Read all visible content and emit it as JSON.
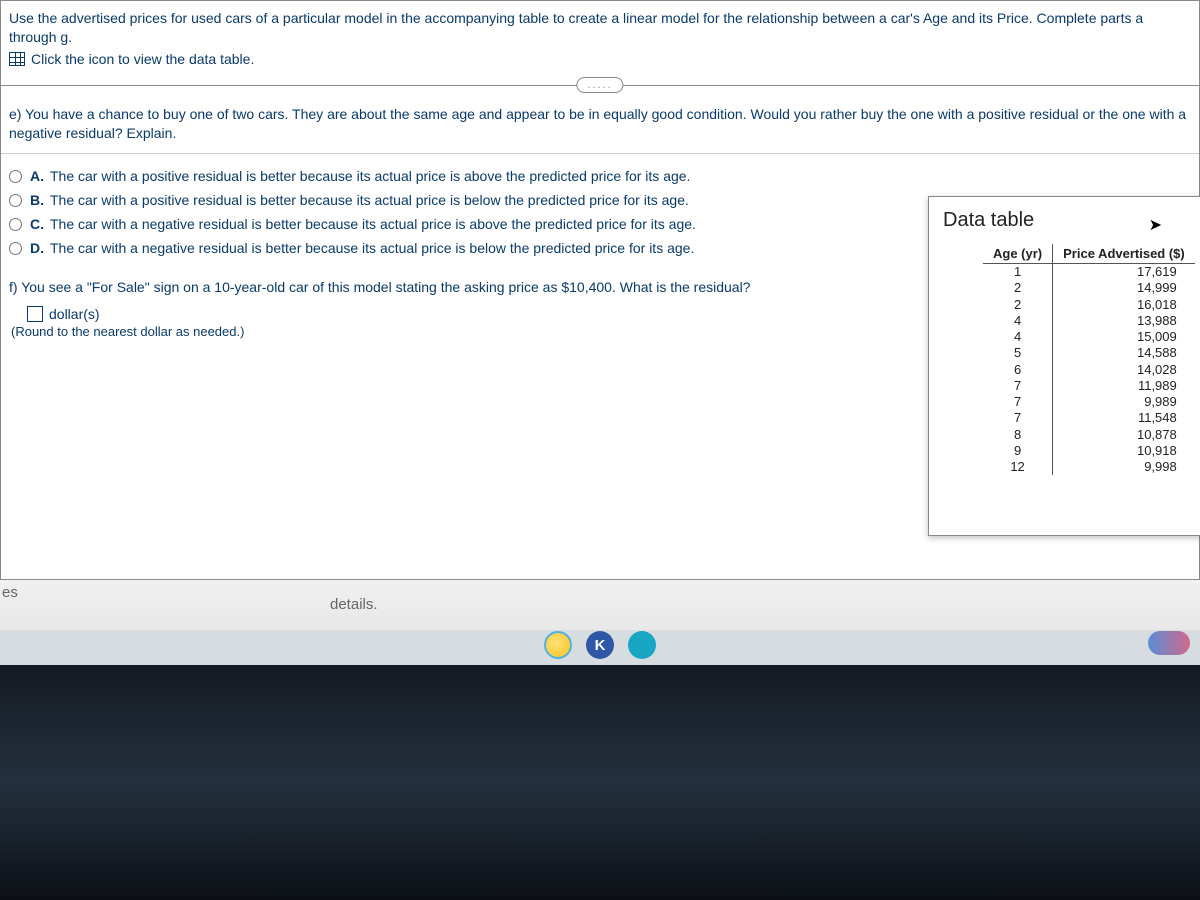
{
  "intro": "Use the advertised prices for used cars of a particular model in the accompanying table to create a linear model for the relationship between a car's Age and its Price. Complete parts a through g.",
  "dataLinkText": "Click the icon to view the data table.",
  "divider": ".....",
  "questionE": "e) You have a chance to buy one of two cars. They are about the same age and appear to be in equally good condition. Would you rather buy the one with a positive residual or the one with a negative residual? Explain.",
  "options": [
    {
      "key": "A.",
      "text": "The car with a positive residual is better because its actual price is above the predicted price for its age."
    },
    {
      "key": "B.",
      "text": "The car with a positive residual is better because its actual price is below the predicted price for its age."
    },
    {
      "key": "C.",
      "text": "The car with a negative residual is better because its actual price is above the predicted price for its age."
    },
    {
      "key": "D.",
      "text": "The car with a negative residual is better because its actual price is below the predicted price for its age."
    }
  ],
  "questionF": "f) You see a \"For Sale\" sign on a 10-year-old car of this model stating the asking price as $10,400. What is the residual?",
  "answerUnit": "dollar(s)",
  "answerHint": "(Round to the nearest dollar as needed.)",
  "popup": {
    "title": "Data table",
    "headers": {
      "age": "Age (yr)",
      "price": "Price Advertised ($)"
    },
    "rows": [
      {
        "age": "1",
        "price": "17,619"
      },
      {
        "age": "2",
        "price": "14,999"
      },
      {
        "age": "2",
        "price": "16,018"
      },
      {
        "age": "4",
        "price": "13,988"
      },
      {
        "age": "4",
        "price": "15,009"
      },
      {
        "age": "5",
        "price": "14,588"
      },
      {
        "age": "6",
        "price": "14,028"
      },
      {
        "age": "7",
        "price": "11,989"
      },
      {
        "age": "7",
        "price": "9,989"
      },
      {
        "age": "7",
        "price": "11,548"
      },
      {
        "age": "8",
        "price": "10,878"
      },
      {
        "age": "9",
        "price": "10,918"
      },
      {
        "age": "12",
        "price": "9,998"
      }
    ]
  },
  "footer": {
    "left": "es",
    "details": "details."
  },
  "taskbar": {
    "icon2": "K"
  }
}
